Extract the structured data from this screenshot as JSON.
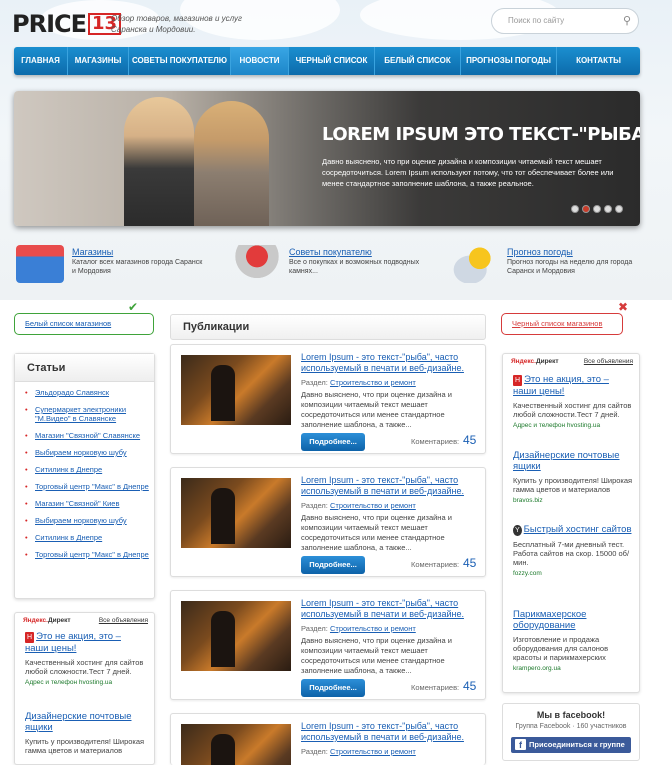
{
  "logo": {
    "text": "PRICE",
    "box": "13"
  },
  "tagline": "Обзор товаров, магазинов и услуг Саранска и Мордовии.",
  "search": {
    "placeholder": "Поиск по сайту"
  },
  "nav": [
    "ГЛАВНАЯ",
    "МАГАЗИНЫ",
    "СОВЕТЫ ПОКУПАТЕЛЮ",
    "НОВОСТИ",
    "ЧЕРНЫЙ СПИСОК",
    "БЕЛЫЙ СПИСОК",
    "ПРОГНОЗЫ ПОГОДЫ",
    "КОНТАКТЫ"
  ],
  "nav_active": "НОВОСТИ",
  "slider": {
    "title": "LOREM IPSUM ЭТО ТЕКСТ-\"РЫБА\"",
    "desc": "Давно выяснено, что при оценке дизайна и композиции читаемый текст мешает сосредоточиться. Lorem Ipsum используют потому, что тот обеспечивает более или менее стандартное заполнение шаблона, а также реальное."
  },
  "features": [
    {
      "title": "Магазины",
      "desc": "Каталог всех магазинов города Саранск и Мордовия",
      "icon": "store-icon"
    },
    {
      "title": "Советы покупателю",
      "desc": "Все о покупках и возможных подводных камнях...",
      "icon": "cart-icon"
    },
    {
      "title": "Прогноз погоды",
      "desc": "Прогноз погоды на неделю для города Саранск и Мордовия",
      "icon": "weather-icon"
    }
  ],
  "white_list": "Белый список магазинов",
  "black_list": "Черный список магазинов",
  "articles": {
    "title": "Статьи",
    "items": [
      "Эльдорадо Славянск",
      "Супермаркет электроники \"М.Видео\" в Славянске",
      "Магазин \"Связной\" Славянске",
      "Выбираем норковую шубу",
      "Ситилинк в Днепре",
      "Торговый центр \"Макс\" в Днепре",
      "Магазин \"Связной\" Киев",
      "Выбираем норковую шубу",
      "Ситилинк в Днепре",
      "Торговый центр \"Макс\" в Днепре"
    ]
  },
  "publications": {
    "title": "Публикации",
    "post": {
      "title": "Lorem Ipsum - это текст-\"рыба\", часто используемый в печати и веб-дизайне.",
      "section_label": "Раздел:",
      "section": "Строительство и ремонт",
      "excerpt": "Давно выяснено, что при оценке дизайна и композиции читаемый текст мешает сосредоточиться или менее стандартное заполнение шаблона, а также...",
      "more": "Подробнее...",
      "comments_label": "Коментариев:",
      "comments": "45"
    }
  },
  "ad": {
    "label_a": "Яндекс.",
    "label_b": "Директ",
    "all": "Все объявления"
  },
  "ads_left": [
    {
      "title": "Это не акция, это – наши цены!",
      "badge": "H",
      "body": "Качественный хостинг для сайтов любой сложности.Тест 7 дней.",
      "url": "Адрес и телефон  hvosting.ua"
    },
    {
      "title": "Дизайнерские почтовые ящики",
      "badge": "",
      "body": "Купить у производителя! Широкая гамма цветов и материалов",
      "url": ""
    }
  ],
  "ads_right": [
    {
      "title": "Это не акция, это – наши цены!",
      "badge": "H",
      "body": "Качественный хостинг для сайтов любой сложности.Тест 7 дней.",
      "url": "Адрес и телефон  hvosting.ua"
    },
    {
      "title": "Дизайнерские почтовые ящики",
      "badge": "",
      "body": "Купить у производителя! Широкая гамма цветов и материалов",
      "url": "bravos.biz"
    },
    {
      "title": "Быстрый хостинг сайтов",
      "badge": "Y",
      "body": "Бесплатный 7-ми дневный тест. Работа сайтов на скор. 15000 об/мин.",
      "url": "fozzy.com"
    },
    {
      "title": "Парикмахерское оборудование",
      "badge": "",
      "body": "Изготовление и продажа оборудования для салонов красоты и парикмахерских",
      "url": "krampero.org.ua"
    }
  ],
  "facebook": {
    "title": "Мы в facebook!",
    "sub": "Группа Facebook · 160 участников",
    "button": "Присоединиться к группе"
  },
  "colors": {
    "accent": "#0c6bab",
    "brand_red": "#d62626",
    "link": "#1a5fb4"
  }
}
